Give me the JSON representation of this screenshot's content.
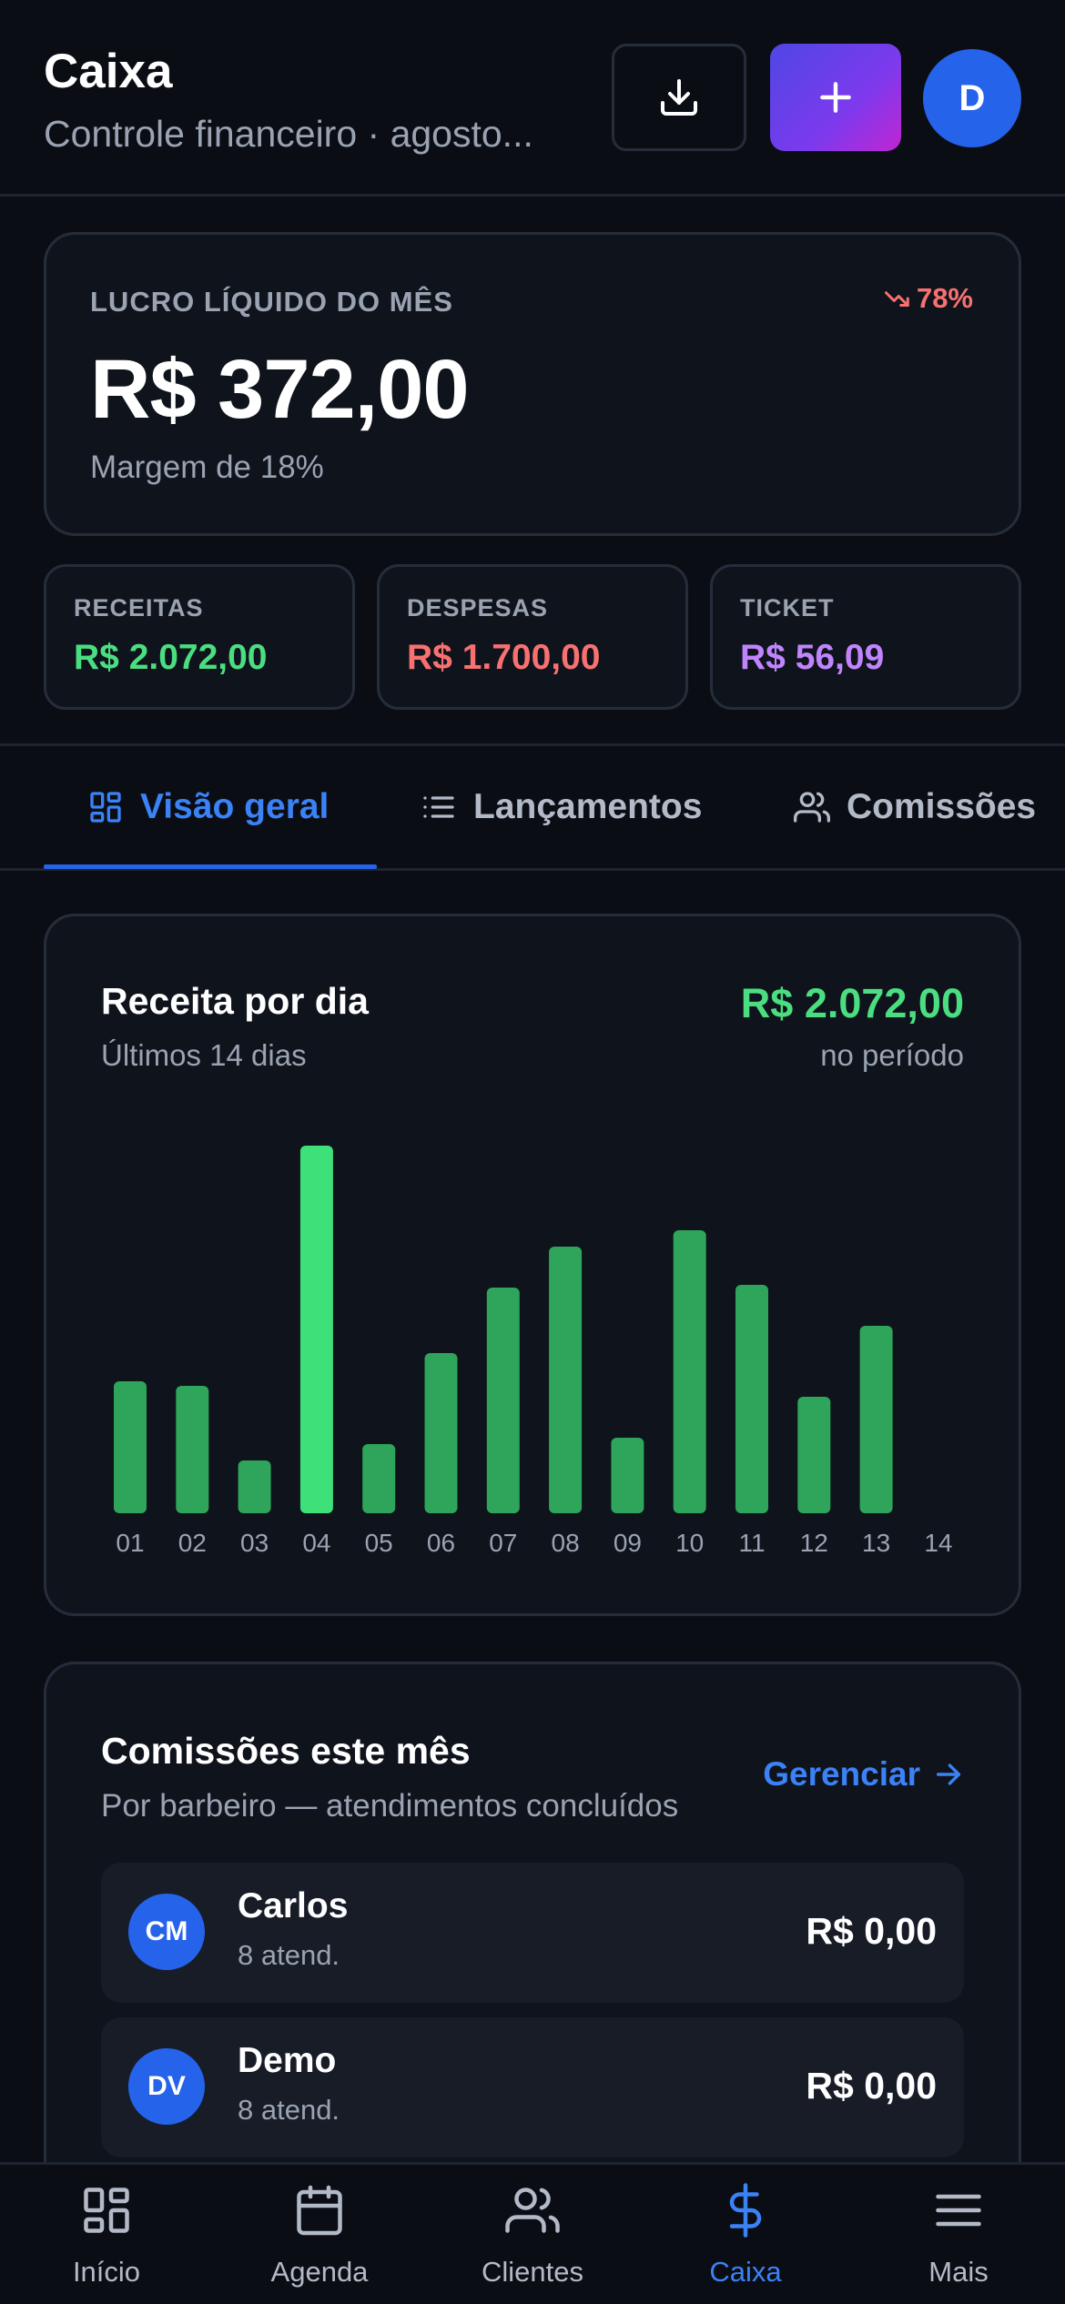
{
  "header": {
    "title": "Caixa",
    "subtitle": "Controle financeiro · agosto...",
    "user_initial": "D"
  },
  "profit": {
    "label": "LUCRO LÍQUIDO DO MÊS",
    "change": "78%",
    "value": "R$ 372,00",
    "margin": "Margem de 18%"
  },
  "stats": [
    {
      "label": "RECEITAS",
      "value": "R$ 2.072,00",
      "color": "#4ade80"
    },
    {
      "label": "DESPESAS",
      "value": "R$ 1.700,00",
      "color": "#f87171"
    },
    {
      "label": "TICKET",
      "value": "R$ 56,09",
      "color": "#c084fc"
    }
  ],
  "tabs": [
    {
      "label": "Visão geral",
      "icon": "grid-icon",
      "active": true
    },
    {
      "label": "Lançamentos",
      "icon": "list-icon",
      "active": false
    },
    {
      "label": "Comissões",
      "icon": "users-icon",
      "active": false
    }
  ],
  "revenue_card": {
    "title": "Receita por dia",
    "subtitle": "Últimos 14 dias",
    "total": "R$ 2.072,00",
    "total_label": "no período"
  },
  "chart_data": {
    "type": "bar",
    "categories": [
      "01",
      "02",
      "03",
      "04",
      "05",
      "06",
      "07",
      "08",
      "09",
      "10",
      "11",
      "12",
      "13",
      "14"
    ],
    "values": [
      145,
      140,
      58,
      404,
      76,
      176,
      248,
      293,
      83,
      311,
      251,
      128,
      206,
      0
    ],
    "highlight_index": 3,
    "bar_color": "#2ea55a",
    "highlight_color": "#3ee07a",
    "ylim": [
      0,
      404
    ]
  },
  "commissions": {
    "title": "Comissões este mês",
    "subtitle": "Por barbeiro — atendimentos concluídos",
    "manage_label": "Gerenciar",
    "barbers": [
      {
        "initials": "CM",
        "name": "Carlos",
        "count": "8 atend.",
        "amount": "R$ 0,00"
      },
      {
        "initials": "DV",
        "name": "Demo",
        "count": "8 atend.",
        "amount": "R$ 0,00"
      }
    ]
  },
  "bottom_nav": [
    {
      "label": "Início",
      "icon": "home-grid-icon",
      "active": false
    },
    {
      "label": "Agenda",
      "icon": "calendar-icon",
      "active": false
    },
    {
      "label": "Clientes",
      "icon": "clients-icon",
      "active": false
    },
    {
      "label": "Caixa",
      "icon": "dollar-icon",
      "active": true
    },
    {
      "label": "Mais",
      "icon": "menu-icon",
      "active": false
    }
  ],
  "colors": {
    "background": "#0a0d14",
    "card": "#0f131c",
    "accent": "#2563eb",
    "positive": "#4ade80",
    "negative": "#f87171"
  }
}
